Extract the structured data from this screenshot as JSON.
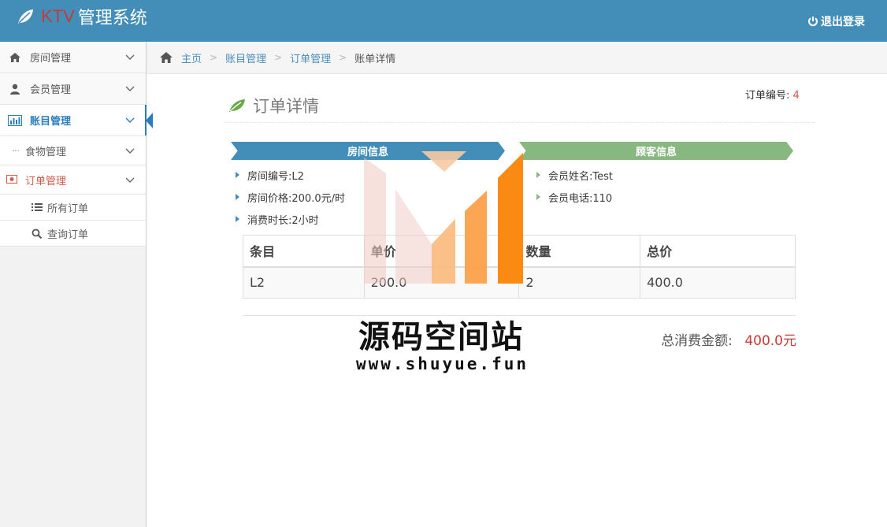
{
  "app": {
    "brand_ktv": "KTV",
    "brand_title": "管理系统",
    "logout_label": "退出登录"
  },
  "sidebar": {
    "items": [
      {
        "label": "房间管理"
      },
      {
        "label": "会员管理"
      },
      {
        "label": "账目管理"
      }
    ],
    "sub_items": [
      {
        "label": "食物管理"
      },
      {
        "label": "订单管理"
      }
    ],
    "subsub_items": [
      {
        "label": "所有订单"
      },
      {
        "label": "查询订单"
      }
    ]
  },
  "breadcrumb": {
    "home": "主页",
    "level1": "账目管理",
    "level2": "订单管理",
    "current": "账单详情"
  },
  "main": {
    "order_no_label": "订单编号:",
    "order_no_value": "4",
    "title": "订单详情",
    "room_ribbon": "房间信息",
    "guest_ribbon": "顾客信息",
    "room_info": [
      {
        "text": "房间编号:L2"
      },
      {
        "text": "房间价格:200.0元/时"
      },
      {
        "text": "消费时长:2小时"
      }
    ],
    "guest_info": [
      {
        "text": "会员姓名:Test"
      },
      {
        "text": "会员电话:110"
      }
    ],
    "table": {
      "headers": [
        "条目",
        "单价",
        "数量",
        "总价"
      ],
      "rows": [
        [
          "L2",
          "200.0",
          "2",
          "400.0"
        ]
      ]
    },
    "total_label": "总消费金额:",
    "total_value": "400.0元"
  },
  "watermark": {
    "title": "源码空间站",
    "url": "www.shuyue.fun"
  },
  "colors": {
    "topbar": "#438eb9",
    "room_ribbon": "#438eb9",
    "guest_ribbon": "#87b87f",
    "accent_red": "#c43c35",
    "link": "#4c8fbd"
  }
}
